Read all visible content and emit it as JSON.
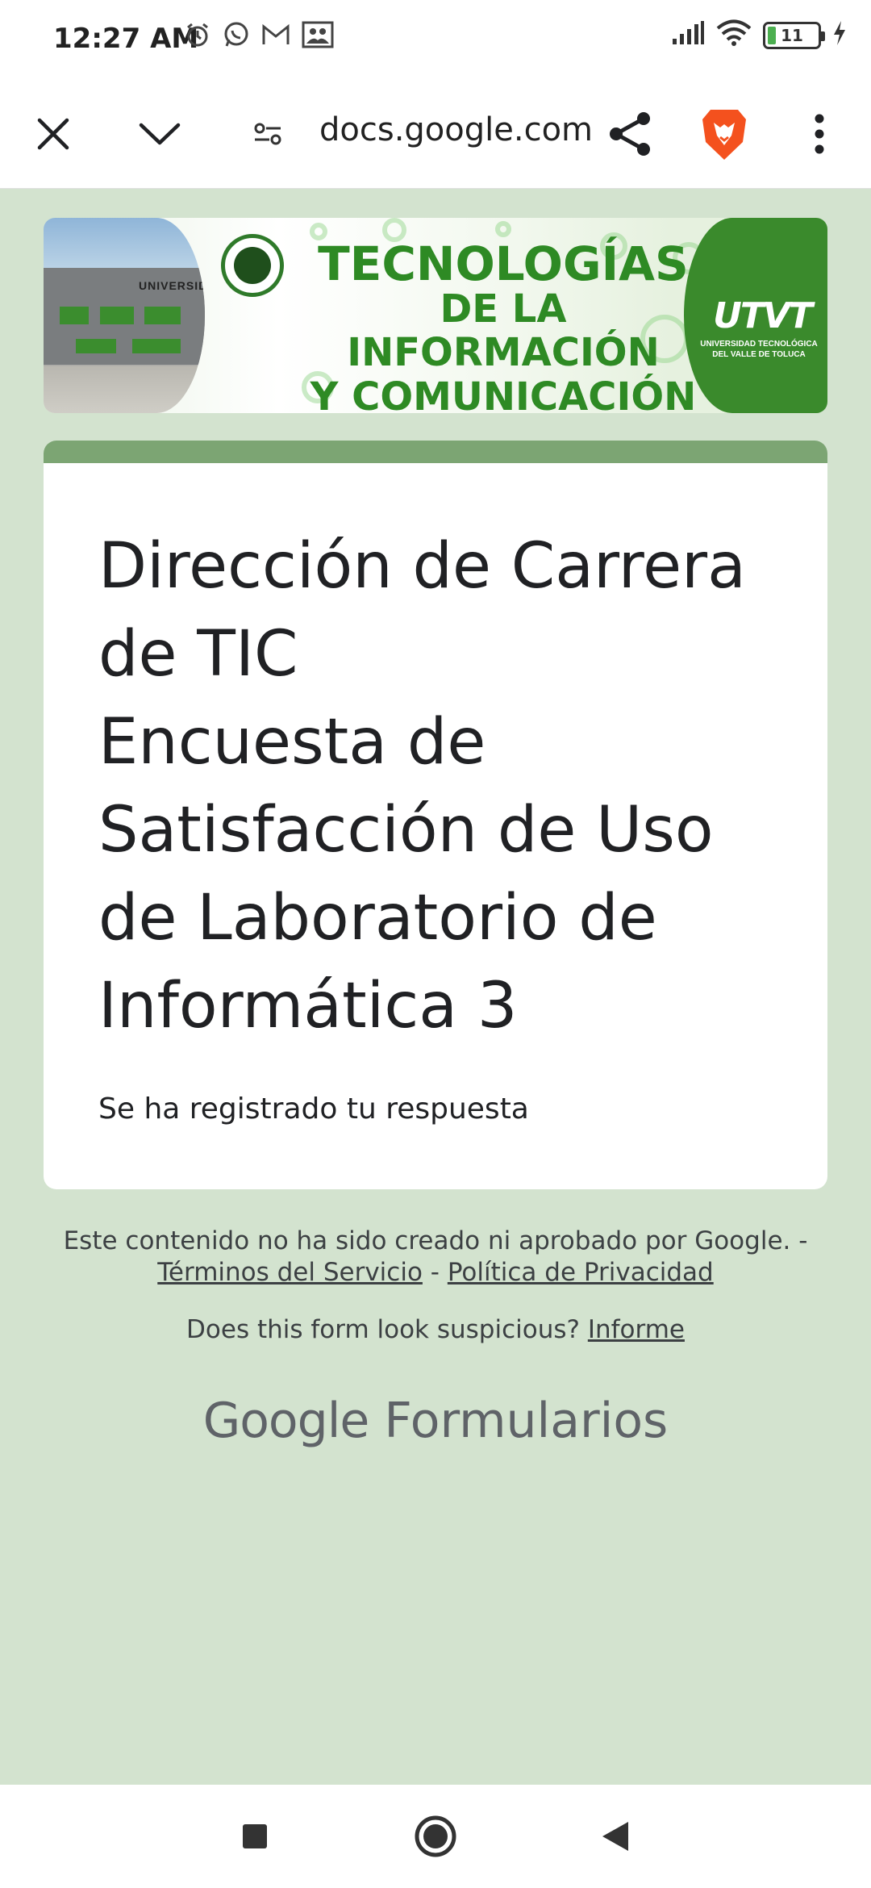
{
  "status_bar": {
    "time": "12:27 AM",
    "left_icons": [
      "alarm-icon",
      "whatsapp-icon",
      "gmail-icon",
      "gallery-icon"
    ],
    "right_icons": [
      "signal-icon",
      "wifi-icon",
      "battery-icon",
      "charging-icon"
    ],
    "battery_level": "11"
  },
  "toolbar": {
    "url": "docs.google.com",
    "icons": [
      "close-icon",
      "chevron-down-icon",
      "site-settings-icon",
      "share-icon",
      "brave-lion-icon",
      "more-vert-icon"
    ]
  },
  "banner": {
    "line1": "TECNOLOGÍAS",
    "line2": "DE LA INFORMACIÓN",
    "line3": "Y COMUNICACIÓN",
    "building_sign": "UNIVERSIDAD",
    "logo_text": "UTVT",
    "logo_subtitle": "UNIVERSIDAD TECNOLÓGICA DEL VALLE DE TOLUCA",
    "accent_color": "#3a8a2c"
  },
  "form": {
    "title": "Dirección de Carrera de TIC\n Encuesta de Satisfacción de Uso de Laboratorio de Informática 3",
    "confirmation": "Se ha registrado tu respuesta",
    "header_color": "#7ca573",
    "background_color": "#d3e3cf"
  },
  "footer": {
    "disclaimer": "Este contenido no ha sido creado ni aprobado por Google. -",
    "terms_link": "Términos del Servicio",
    "separator": "-",
    "privacy_link": "Política de Privacidad",
    "suspicious_text": "Does this form look suspicious?",
    "report_link": "Informe",
    "brand_google": "Google",
    "brand_product": "Formularios"
  },
  "nav_bar": {
    "icons": [
      "recents-square-icon",
      "home-circle-icon",
      "back-triangle-icon"
    ]
  }
}
